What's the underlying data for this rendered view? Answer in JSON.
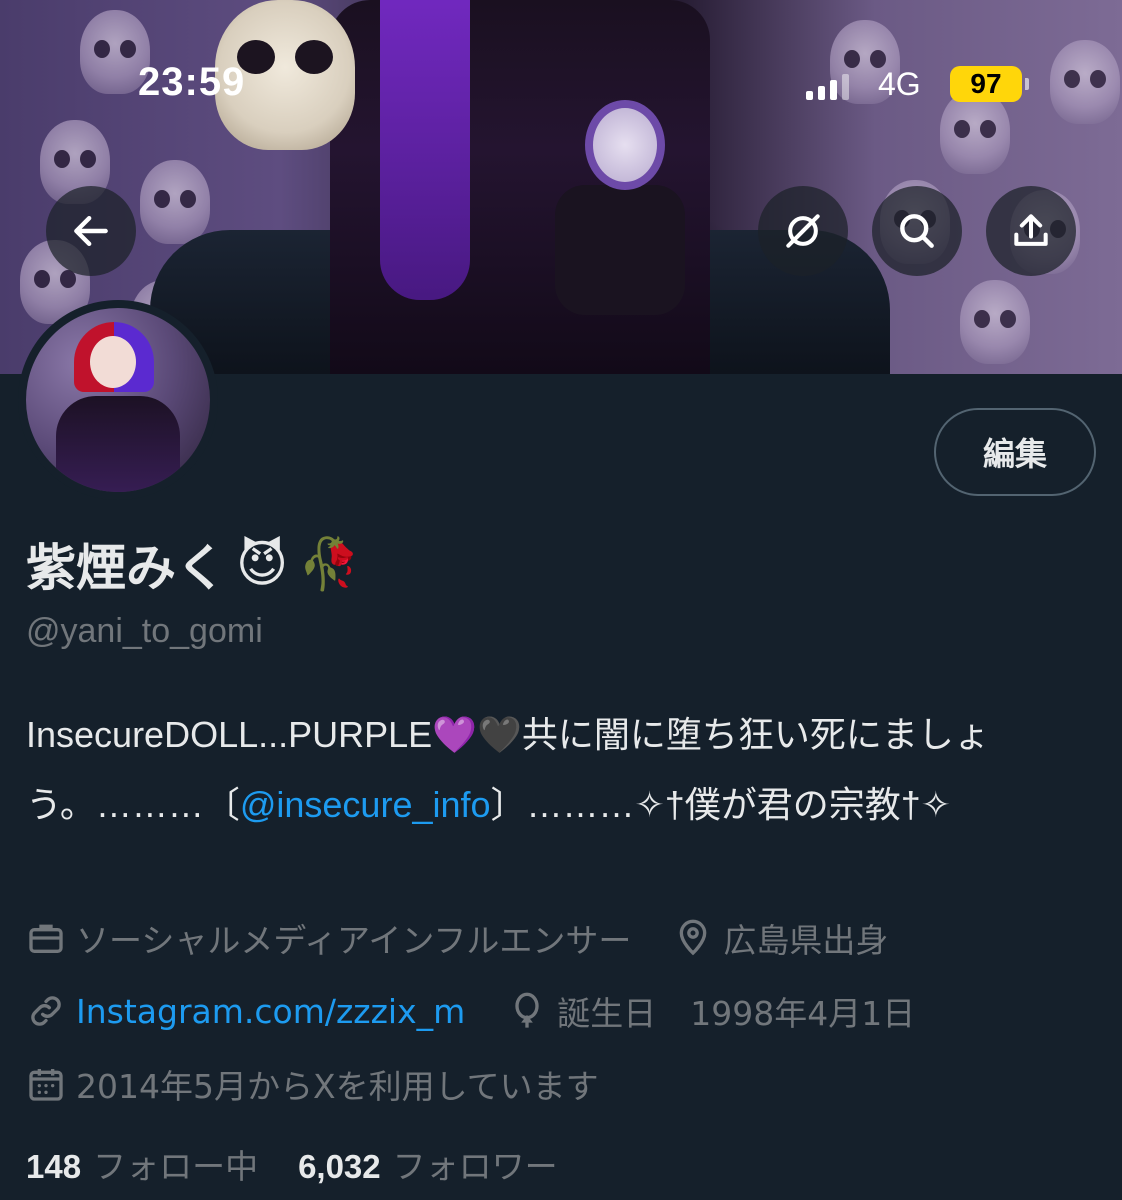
{
  "status_bar": {
    "time": "23:59",
    "network": "4G",
    "battery": "97"
  },
  "profile": {
    "display_name": "紫煙みく",
    "name_emoji_1": "😈",
    "name_emoji_2": "🥀",
    "handle": "@yani_to_gomi",
    "edit_label": "編集",
    "bio": {
      "part1": "InsecureDOLL...PURPLE💜🖤共に闇に堕ち狂い死にましょう。………〔",
      "mention": "@insecure_info",
      "part2": "〕………✧†僕が君の宗教†✧"
    },
    "category": "ソーシャルメディアインフルエンサー",
    "location": "広島県出身",
    "website": "Instagram.com/zzzix_m",
    "birthday_label": "誕生日",
    "birthday_value": "1998年4月1日",
    "joined": "2014年5月からXを利用しています",
    "following_count": "148",
    "following_label": "フォロー中",
    "followers_count": "6,032",
    "followers_label": "フォロワー"
  },
  "icons": {
    "back": "back-arrow-icon",
    "grok": "grok-icon",
    "search": "search-icon",
    "share": "share-icon",
    "category": "briefcase-icon",
    "location": "location-pin-icon",
    "link": "link-icon",
    "birthday": "balloon-icon",
    "calendar": "calendar-icon"
  },
  "colors": {
    "background": "#15202b",
    "link": "#1d9bf0",
    "muted": "#71767b",
    "battery": "#ffd60a"
  }
}
